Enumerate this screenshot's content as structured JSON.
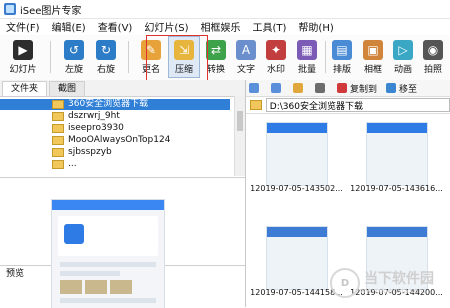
{
  "window": {
    "title": "iSee图片专家"
  },
  "menu": [
    "文件(F)",
    "编辑(E)",
    "查看(V)",
    "幻灯片(S)",
    "相框娱乐",
    "工具(T)",
    "帮助(H)"
  ],
  "toolbar": [
    {
      "label": "幻灯片",
      "icon": "slideshow-icon"
    },
    {
      "label": "左旋",
      "icon": "rotate-left-icon"
    },
    {
      "label": "右旋",
      "icon": "rotate-right-icon"
    },
    {
      "label": "更名",
      "icon": "rename-icon"
    },
    {
      "label": "压缩",
      "icon": "compress-icon"
    },
    {
      "label": "转换",
      "icon": "convert-icon"
    },
    {
      "label": "文字",
      "icon": "text-icon"
    },
    {
      "label": "水印",
      "icon": "watermark-icon"
    },
    {
      "label": "批量",
      "icon": "batch-icon"
    },
    {
      "label": "排版",
      "icon": "layout-icon"
    },
    {
      "label": "相框",
      "icon": "frame-icon"
    },
    {
      "label": "动画",
      "icon": "animation-icon"
    },
    {
      "label": "拍照",
      "icon": "camera-icon"
    }
  ],
  "left_panel": {
    "tabs": [
      "文件夹",
      "截图"
    ],
    "tree": [
      "360安全浏览器下载",
      "dszrwrj_9ht",
      "iseepro3930",
      "MooOAlwaysOnTop124",
      "sjbsspzyb",
      "..."
    ],
    "preview_label": "预览"
  },
  "right_panel": {
    "tools": [
      {
        "label": "",
        "icon": "back-icon"
      },
      {
        "label": "",
        "icon": "forward-icon"
      },
      {
        "label": "",
        "icon": "up-folder-icon"
      },
      {
        "label": "",
        "icon": "view-icon"
      },
      {
        "label": "复制到",
        "icon": "copy-to-icon"
      },
      {
        "label": "移至",
        "icon": "move-to-icon"
      }
    ],
    "path": "D:\\360安全浏览器下载",
    "thumbnails": [
      "12019-07-05-143502...",
      "12019-07-05-143616...",
      "12019-07-05-144158...",
      "12019-07-05-144200..."
    ]
  },
  "watermark": {
    "logo_text": "D",
    "title": "当下软件园",
    "url": "www.downxia.com"
  },
  "colors": {
    "accent": "#2f7fd6",
    "highlight_box": "#e1312f"
  }
}
